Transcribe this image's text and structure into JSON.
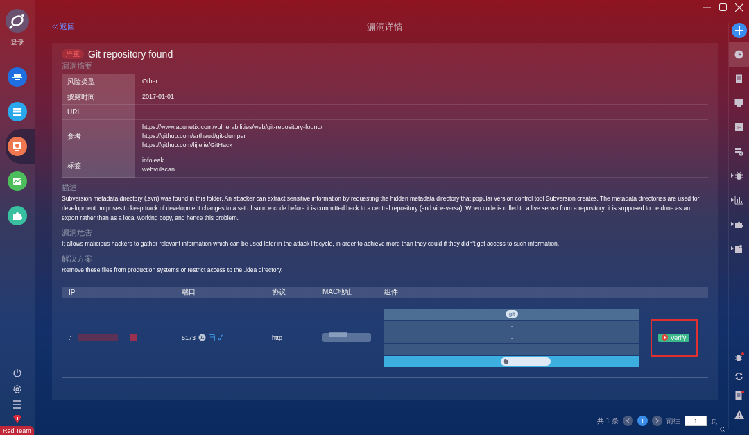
{
  "sidebar": {
    "login_label": "登录",
    "items": [
      {
        "color": "#1f6fe0",
        "selected": false
      },
      {
        "color": "#2aa8ec",
        "selected": false
      },
      {
        "color": "#f07850",
        "selected": true
      },
      {
        "color": "#4cbf5c",
        "selected": false
      },
      {
        "color": "#38c0a0",
        "selected": false
      }
    ],
    "team_label": "Red Team"
  },
  "header": {
    "back": "返回",
    "title": "漏洞详情"
  },
  "vulnerability": {
    "severity": "严重",
    "title": "Git repository found"
  },
  "summary": {
    "heading": "漏洞摘要",
    "rows": [
      {
        "label": "风险类型",
        "values": [
          "Other"
        ]
      },
      {
        "label": "披露时间",
        "values": [
          "2017-01-01"
        ]
      },
      {
        "label": "URL",
        "values": [
          "-"
        ]
      },
      {
        "label": "参考",
        "values": [
          "https://www.acunetix.com/vulnerabilities/web/git-repository-found/",
          "https://github.com/arthaud/git-dumper",
          "https://github.com/lijiejie/GitHack"
        ]
      },
      {
        "label": "标签",
        "values": [
          "infoleak",
          "webvulscan"
        ]
      }
    ]
  },
  "sections": [
    {
      "heading": "描述",
      "text": "Subversion metadata directory (.svn) was found in this folder. An attacker can extract sensitive information by requesting the hidden metadata directory that popular version control tool Subversion creates. The metadata directories are used for development purposes to keep track of development changes to a set of source code before it is committed back to a central repository (and vice-versa). When code is rolled to a live server from a repository, it is supposed to be done as an export rather than as a local working copy, and hence this problem."
    },
    {
      "heading": "漏洞危害",
      "text": "It allows malicious hackers to gather relevant information which can be used later in the attack lifecycle, in order to achieve more than they could if they didn't get access to such information."
    },
    {
      "heading": "解决方案",
      "text": "Remove these files from production systems or restrict access to the .idea directory."
    }
  ],
  "table": {
    "columns": [
      "IP",
      "端口",
      "协议",
      "MAC地址",
      "组件"
    ],
    "rows": [
      {
        "expanded": false,
        "port": "5173",
        "protocol": "http",
        "components": [
          {
            "kind": "tag",
            "text": "git"
          },
          {
            "kind": "plain",
            "text": "-"
          },
          {
            "kind": "plain",
            "text": "-"
          },
          {
            "kind": "plain",
            "text": "-"
          },
          {
            "kind": "os"
          }
        ],
        "action": "Verify"
      }
    ]
  },
  "pagination": {
    "total": "共 1 条",
    "pages": [
      {
        "label": "1",
        "selected": true
      }
    ],
    "goto_label": "前往",
    "page_input": "1",
    "page_suffix": "页"
  },
  "right_bar": {
    "items": [
      {
        "expandable": false,
        "selected": true
      },
      {
        "expandable": false,
        "selected": false
      },
      {
        "expandable": false,
        "selected": false
      },
      {
        "expandable": false,
        "selected": false
      },
      {
        "expandable": false,
        "selected": false
      },
      {
        "expandable": true,
        "selected": false
      },
      {
        "expandable": true,
        "selected": false
      },
      {
        "expandable": true,
        "selected": false
      },
      {
        "expandable": true,
        "selected": false
      }
    ],
    "ip_label": "IP"
  }
}
